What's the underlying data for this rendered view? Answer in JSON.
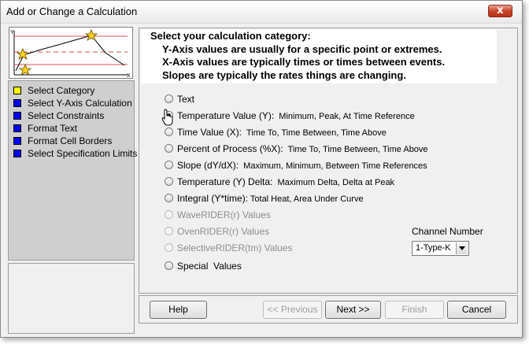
{
  "window": {
    "title": "Add or Change a Calculation",
    "close_symbol": "x"
  },
  "left_panel": {
    "graph": {
      "y_axis_label": "Y",
      "x_axis_label": "X"
    },
    "nav_items": [
      {
        "label": "Select Category",
        "color": "#ffff00"
      },
      {
        "label": "Select Y-Axis Calculation",
        "color": "#0000ff"
      },
      {
        "label": "Select Constraints",
        "color": "#0000ff"
      },
      {
        "label": "Format Text",
        "color": "#0000ff"
      },
      {
        "label": "Format Cell Borders",
        "color": "#0000ff"
      },
      {
        "label": "Select Specification Limits",
        "color": "#0000ff"
      }
    ]
  },
  "header": {
    "title": "Select your calculation category:",
    "lines": [
      "Y-Axis values are usually for a specific point or extremes.",
      "X-Axis values are typically times or times between events.",
      "Slopes are typically the rates things are changing."
    ]
  },
  "options": [
    {
      "name": "Text",
      "detail": "",
      "checked": false,
      "enabled": true
    },
    {
      "name": "Temperature Value (Y):",
      "detail": "  Minimum, Peak, At Time Reference",
      "checked": true,
      "enabled": true
    },
    {
      "name": "Time Value (X):",
      "detail": "  Time To, Time Between, Time Above",
      "checked": false,
      "enabled": true
    },
    {
      "name": "Percent of Process (%X):",
      "detail": "  Time To, Time Between, Time Above",
      "checked": false,
      "enabled": true
    },
    {
      "name": "Slope (dY/dX):",
      "detail": "  Maximum, Minimum, Between Time References",
      "checked": false,
      "enabled": true
    },
    {
      "name": "Temperature (Y) Delta:",
      "detail": "  Maximum Delta, Delta at Peak",
      "checked": false,
      "enabled": true
    },
    {
      "name": "Integral (Y*time):",
      "detail": " Total Heat, Area Under Curve",
      "checked": false,
      "enabled": true
    },
    {
      "name": "WaveRIDER(r) Values",
      "detail": "",
      "checked": false,
      "enabled": false
    },
    {
      "name": "OvenRIDER(r) Values",
      "detail": "",
      "checked": false,
      "enabled": false
    },
    {
      "name": "SelectiveRIDER(tm) Values",
      "detail": "",
      "checked": false,
      "enabled": false
    },
    {
      "name": "Special  Values",
      "detail": "",
      "checked": false,
      "enabled": true
    }
  ],
  "channel": {
    "label": "Channel Number",
    "value": "1-Type-K"
  },
  "buttons": {
    "help": "Help",
    "previous": "<< Previous",
    "next": "Next >>",
    "finish": "Finish",
    "cancel": "Cancel"
  }
}
